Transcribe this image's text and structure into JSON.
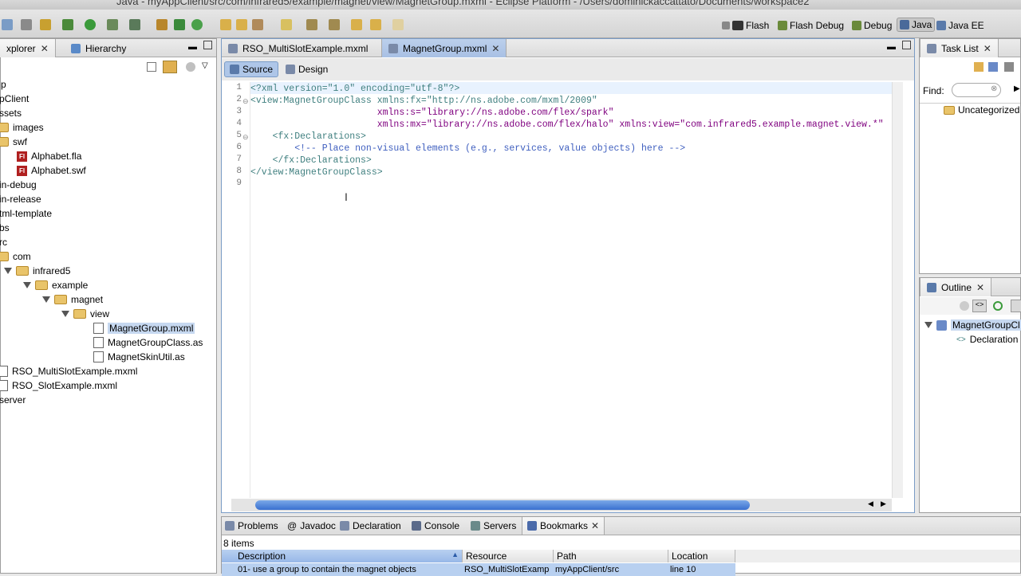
{
  "window": {
    "title": "Java - myAppClient/src/com/infrared5/example/magnet/view/MagnetGroup.mxml - Eclipse Platform - /Users/dominickaccattato/Documents/workspace2"
  },
  "perspectives": [
    {
      "label": "Flash"
    },
    {
      "label": "Flash Debug"
    },
    {
      "label": "Debug"
    },
    {
      "label": "Java"
    },
    {
      "label": "Java EE"
    }
  ],
  "explorer": {
    "tabs": [
      {
        "label": "xplorer"
      },
      {
        "label": "Hierarchy"
      }
    ],
    "tree": [
      {
        "label": "p"
      },
      {
        "label": "pClient"
      },
      {
        "label": "ssets"
      },
      {
        "label": "images"
      },
      {
        "label": "swf"
      },
      {
        "label": "Alphabet.fla"
      },
      {
        "label": "Alphabet.swf"
      },
      {
        "label": "in-debug"
      },
      {
        "label": "in-release"
      },
      {
        "label": "tml-template"
      },
      {
        "label": "bs"
      },
      {
        "label": "rc"
      },
      {
        "label": "com"
      },
      {
        "label": "infrared5"
      },
      {
        "label": "example"
      },
      {
        "label": "magnet"
      },
      {
        "label": "view"
      },
      {
        "label": "MagnetGroup.mxml"
      },
      {
        "label": "MagnetGroupClass.as"
      },
      {
        "label": "MagnetSkinUtil.as"
      },
      {
        "label": "RSO_MultiSlotExample.mxml"
      },
      {
        "label": "RSO_SlotExample.mxml"
      },
      {
        "label": "server"
      }
    ]
  },
  "editor": {
    "tabs": [
      {
        "label": "RSO_MultiSlotExample.mxml"
      },
      {
        "label": "MagnetGroup.mxml"
      }
    ],
    "modes": [
      {
        "label": "Source"
      },
      {
        "label": "Design"
      }
    ],
    "line_numbers": [
      "1",
      "2",
      "3",
      "4",
      "5",
      "6",
      "7",
      "8",
      "9"
    ],
    "lines": [
      "<?xml version=\"1.0\" encoding=\"utf-8\"?>",
      "<view:MagnetGroupClass xmlns:fx=\"http://ns.adobe.com/mxml/2009\"",
      "                       xmlns:s=\"library://ns.adobe.com/flex/spark\"",
      "                       xmlns:mx=\"library://ns.adobe.com/flex/halo\" xmlns:view=\"com.infrared5.example.magnet.view.*\"",
      "    <fx:Declarations>",
      "        <!-- Place non-visual elements (e.g., services, value objects) here -->",
      "    </fx:Declarations>",
      "</view:MagnetGroupClass>",
      ""
    ]
  },
  "tasklist": {
    "tab": "Task List",
    "find_label": "Find:",
    "category": "Uncategorized"
  },
  "outline": {
    "tab": "Outline",
    "items": [
      {
        "label": "MagnetGroupCl"
      },
      {
        "label": "Declaration"
      }
    ]
  },
  "bottom": {
    "tabs": [
      {
        "label": "Problems"
      },
      {
        "label": "Javadoc"
      },
      {
        "label": "Declaration"
      },
      {
        "label": "Console"
      },
      {
        "label": "Servers"
      },
      {
        "label": "Bookmarks"
      }
    ],
    "count": "8 items",
    "columns": [
      {
        "label": "Description"
      },
      {
        "label": "Resource"
      },
      {
        "label": "Path"
      },
      {
        "label": "Location"
      }
    ],
    "rows": [
      {
        "description": "01- use a group to contain the magnet objects",
        "resource": "RSO_MultiSlotExamp",
        "path": "myAppClient/src",
        "location": "line 10"
      }
    ]
  }
}
